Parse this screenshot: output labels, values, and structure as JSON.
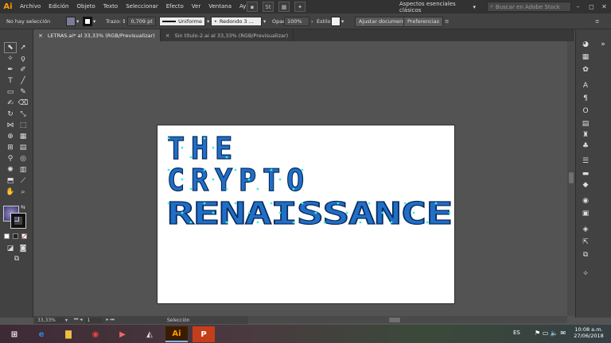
{
  "app": {
    "logo": "Ai"
  },
  "menu": [
    "Archivo",
    "Edición",
    "Objeto",
    "Texto",
    "Seleccionar",
    "Efecto",
    "Ver",
    "Ventana",
    "Ayuda"
  ],
  "menubar": {
    "workspace": "Aspectos esenciales clásicos",
    "search_placeholder": "Buscar en Adobe Stock",
    "stock_icon": "St"
  },
  "control": {
    "selection": "No hay selección",
    "stroke_label": "Trazo:",
    "stroke_value": "0,709 pt",
    "profile": "Uniforme",
    "brush": "Redondo 3 ...",
    "opacity_label": "Opacidad:",
    "opacity_value": "100%",
    "style_label": "Estilo:",
    "doc_setup": "Ajustar documento",
    "prefs": "Preferencias"
  },
  "tabs": [
    {
      "label": "LETRAS.ai* al 33,33% (RGB/Previsualizar)"
    },
    {
      "label": "Sin título-2.ai al 33,33% (RGB/Previsualizar)"
    }
  ],
  "artwork": {
    "lines": [
      "THE",
      "CRYPTO",
      "RENAISSANCE"
    ],
    "fill_color": "#1f6fc8",
    "stroke_color": "#0a2a5a",
    "anchor_color": "#3af0e0"
  },
  "status": {
    "zoom": "33,33%",
    "artboard": "1",
    "tool": "Selección"
  },
  "taskbar": {
    "lang": "ES",
    "time": "10:08 a.m.",
    "date": "27/06/2018"
  },
  "colors": {
    "accent": "#ff9a00",
    "panel": "#424242",
    "canvas": "#535353"
  }
}
